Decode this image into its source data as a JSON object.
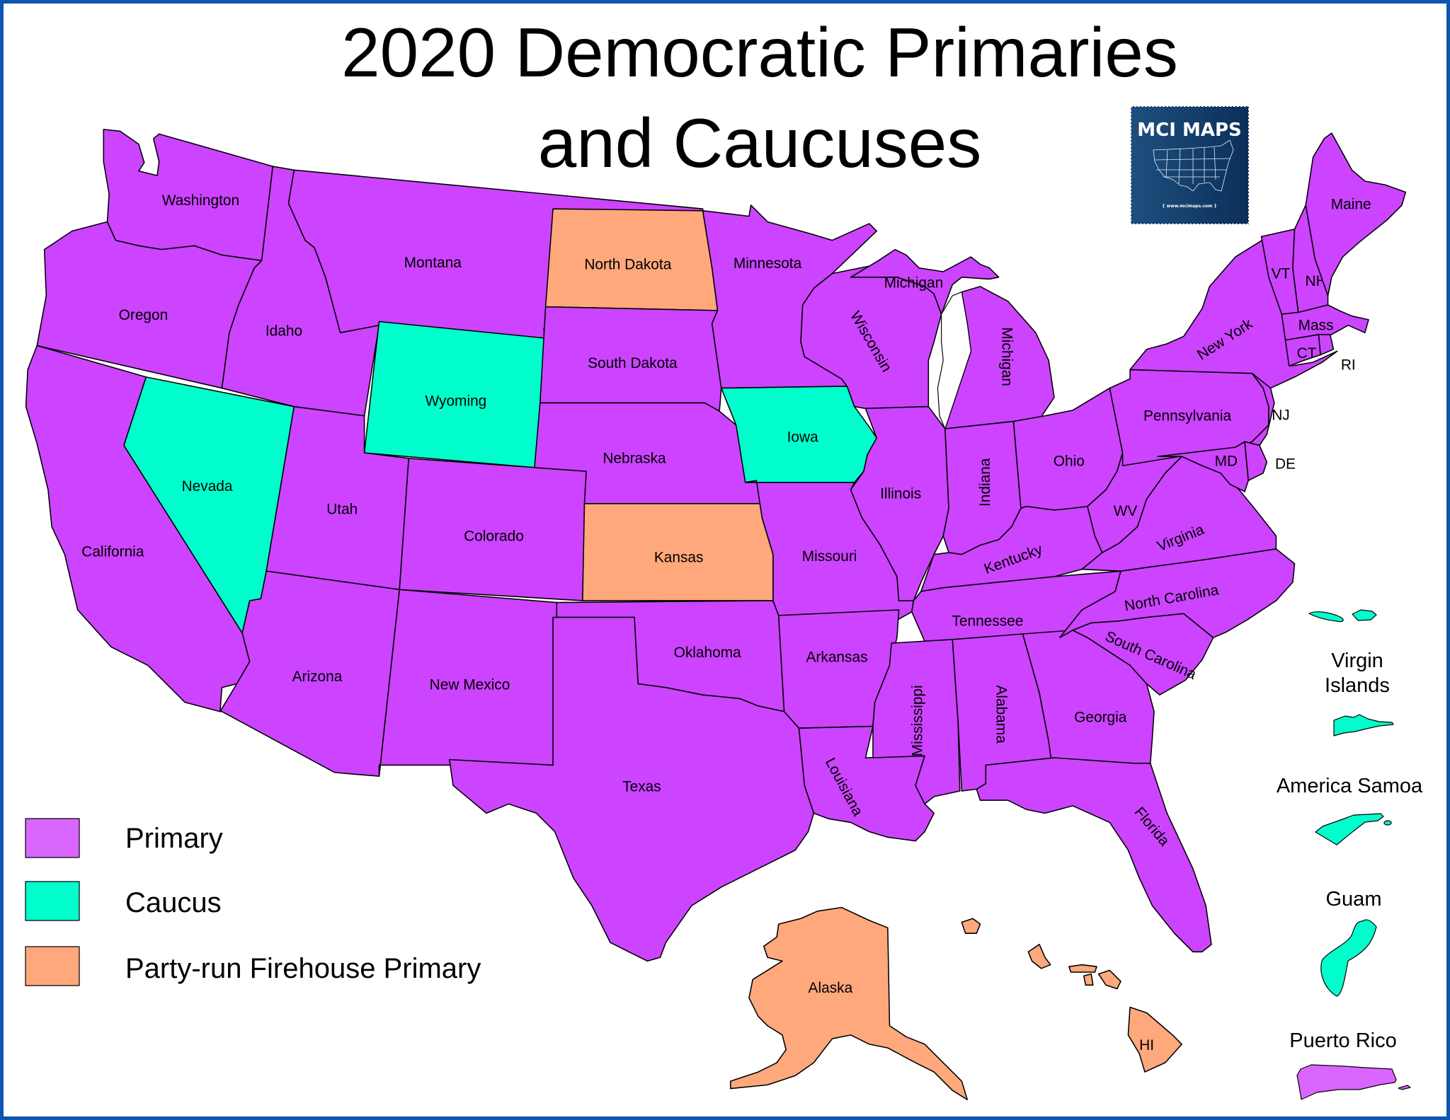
{
  "title": {
    "line1": "2020 Democratic Primaries",
    "line2": "and Caucuses"
  },
  "logo": {
    "name": "MCI MAPS",
    "url": "{ www.mcimaps.com }"
  },
  "colors": {
    "primary": "#cc44ff",
    "primary_legend": "#d966ff",
    "caucus": "#00ffcc",
    "firehouse": "#ffa87c",
    "frame": "#0a56b0"
  },
  "legend": [
    {
      "key": "primary",
      "label": "Primary"
    },
    {
      "key": "caucus",
      "label": "Caucus"
    },
    {
      "key": "firehouse",
      "label": "Party-run Firehouse Primary"
    }
  ],
  "states": {
    "WA": {
      "label": "Washington",
      "type": "primary"
    },
    "OR": {
      "label": "Oregon",
      "type": "primary"
    },
    "CA": {
      "label": "California",
      "type": "primary"
    },
    "ID": {
      "label": "Idaho",
      "type": "primary"
    },
    "NV": {
      "label": "Nevada",
      "type": "caucus"
    },
    "MT": {
      "label": "Montana",
      "type": "primary"
    },
    "WY": {
      "label": "Wyoming",
      "type": "caucus"
    },
    "UT": {
      "label": "Utah",
      "type": "primary"
    },
    "AZ": {
      "label": "Arizona",
      "type": "primary"
    },
    "CO": {
      "label": "Colorado",
      "type": "primary"
    },
    "NM": {
      "label": "New Mexico",
      "type": "primary"
    },
    "ND": {
      "label": "North Dakota",
      "type": "firehouse"
    },
    "SD": {
      "label": "South Dakota",
      "type": "primary"
    },
    "NE": {
      "label": "Nebraska",
      "type": "primary"
    },
    "KS": {
      "label": "Kansas",
      "type": "firehouse"
    },
    "OK": {
      "label": "Oklahoma",
      "type": "primary"
    },
    "TX": {
      "label": "Texas",
      "type": "primary"
    },
    "MN": {
      "label": "Minnesota",
      "type": "primary"
    },
    "IA": {
      "label": "Iowa",
      "type": "caucus"
    },
    "MO": {
      "label": "Missouri",
      "type": "primary"
    },
    "AR": {
      "label": "Arkansas",
      "type": "primary"
    },
    "LA": {
      "label": "Louisiana",
      "type": "primary"
    },
    "WI": {
      "label": "Wisconsin",
      "type": "primary"
    },
    "MI_UP": {
      "label": "Michigan",
      "type": "primary"
    },
    "MI": {
      "label": "Michigan",
      "type": "primary"
    },
    "IL": {
      "label": "Illinois",
      "type": "primary"
    },
    "IN": {
      "label": "Indiana",
      "type": "primary"
    },
    "OH": {
      "label": "Ohio",
      "type": "primary"
    },
    "KY": {
      "label": "Kentucky",
      "type": "primary"
    },
    "TN": {
      "label": "Tennessee",
      "type": "primary"
    },
    "MS": {
      "label": "Mississippi",
      "type": "primary"
    },
    "AL": {
      "label": "Alabama",
      "type": "primary"
    },
    "GA": {
      "label": "Georgia",
      "type": "primary"
    },
    "FL": {
      "label": "Florida",
      "type": "primary"
    },
    "SC": {
      "label": "South Carolina",
      "type": "primary"
    },
    "NC": {
      "label": "North Carolina",
      "type": "primary"
    },
    "VA": {
      "label": "Virginia",
      "type": "primary"
    },
    "WV": {
      "label": "WV",
      "type": "primary"
    },
    "PA": {
      "label": "Pennsylvania",
      "type": "primary"
    },
    "NY": {
      "label": "New York",
      "type": "primary"
    },
    "NJ": {
      "label": "NJ",
      "type": "primary"
    },
    "DE": {
      "label": "DE",
      "type": "primary"
    },
    "MD": {
      "label": "MD",
      "type": "primary"
    },
    "CT": {
      "label": "CT",
      "type": "primary"
    },
    "RI": {
      "label": "RI",
      "type": "primary"
    },
    "MA": {
      "label": "Mass",
      "type": "primary"
    },
    "VT": {
      "label": "VT",
      "type": "primary"
    },
    "NH": {
      "label": "NH",
      "type": "primary"
    },
    "ME": {
      "label": "Maine",
      "type": "primary"
    },
    "AK": {
      "label": "Alaska",
      "type": "firehouse"
    },
    "HI": {
      "label": "HI",
      "type": "firehouse"
    }
  },
  "territories": {
    "VI": {
      "label_line1": "Virgin",
      "label_line2": "Islands",
      "type": "caucus"
    },
    "AS": {
      "label": "America Samoa",
      "type": "caucus"
    },
    "GU": {
      "label": "Guam",
      "type": "caucus"
    },
    "PR": {
      "label": "Puerto Rico",
      "type": "primary"
    }
  }
}
